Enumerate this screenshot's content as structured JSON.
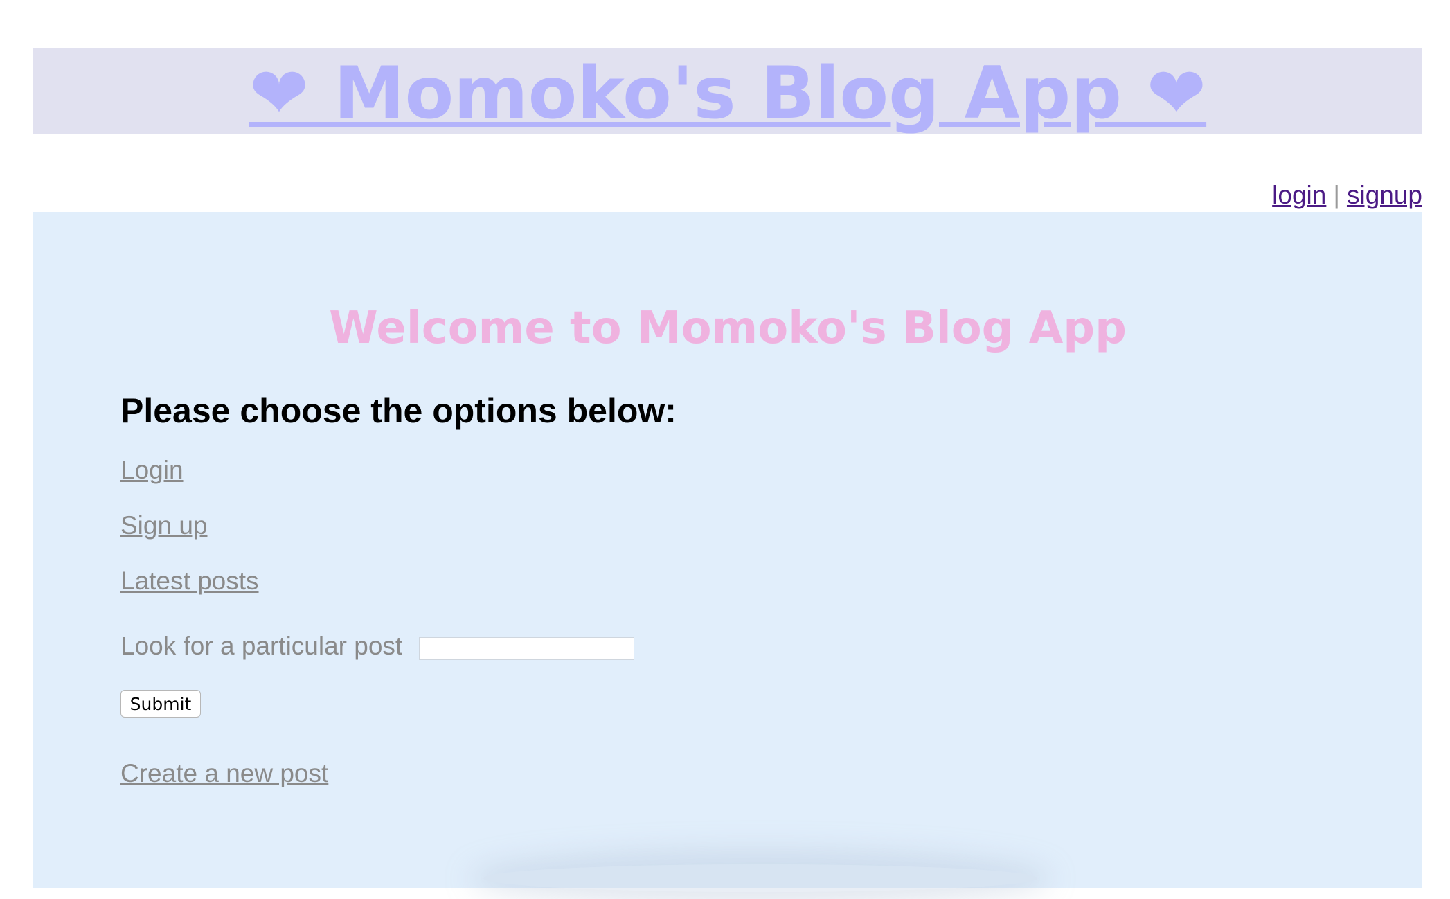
{
  "header": {
    "title": "❤ Momoko's Blog App ❤"
  },
  "top_nav": {
    "login_label": "login",
    "separator": "|",
    "signup_label": "signup"
  },
  "main": {
    "welcome_title": "Welcome to Momoko's Blog App",
    "choose_heading": "Please choose the options below:",
    "options": {
      "login": "Login",
      "signup": "Sign up",
      "latest_posts": "Latest posts",
      "create_post": "Create a new post"
    },
    "search": {
      "label": "Look for a particular post",
      "value": "",
      "placeholder": "",
      "submit_label": "Submit"
    }
  },
  "colors": {
    "header_background": "#e1e1f0",
    "header_text": "#b3b3fb",
    "panel_background": "#e1eefb",
    "welcome_text": "#efb2df",
    "link_gray": "#8a8a8a",
    "nav_link": "#4b1a85"
  }
}
